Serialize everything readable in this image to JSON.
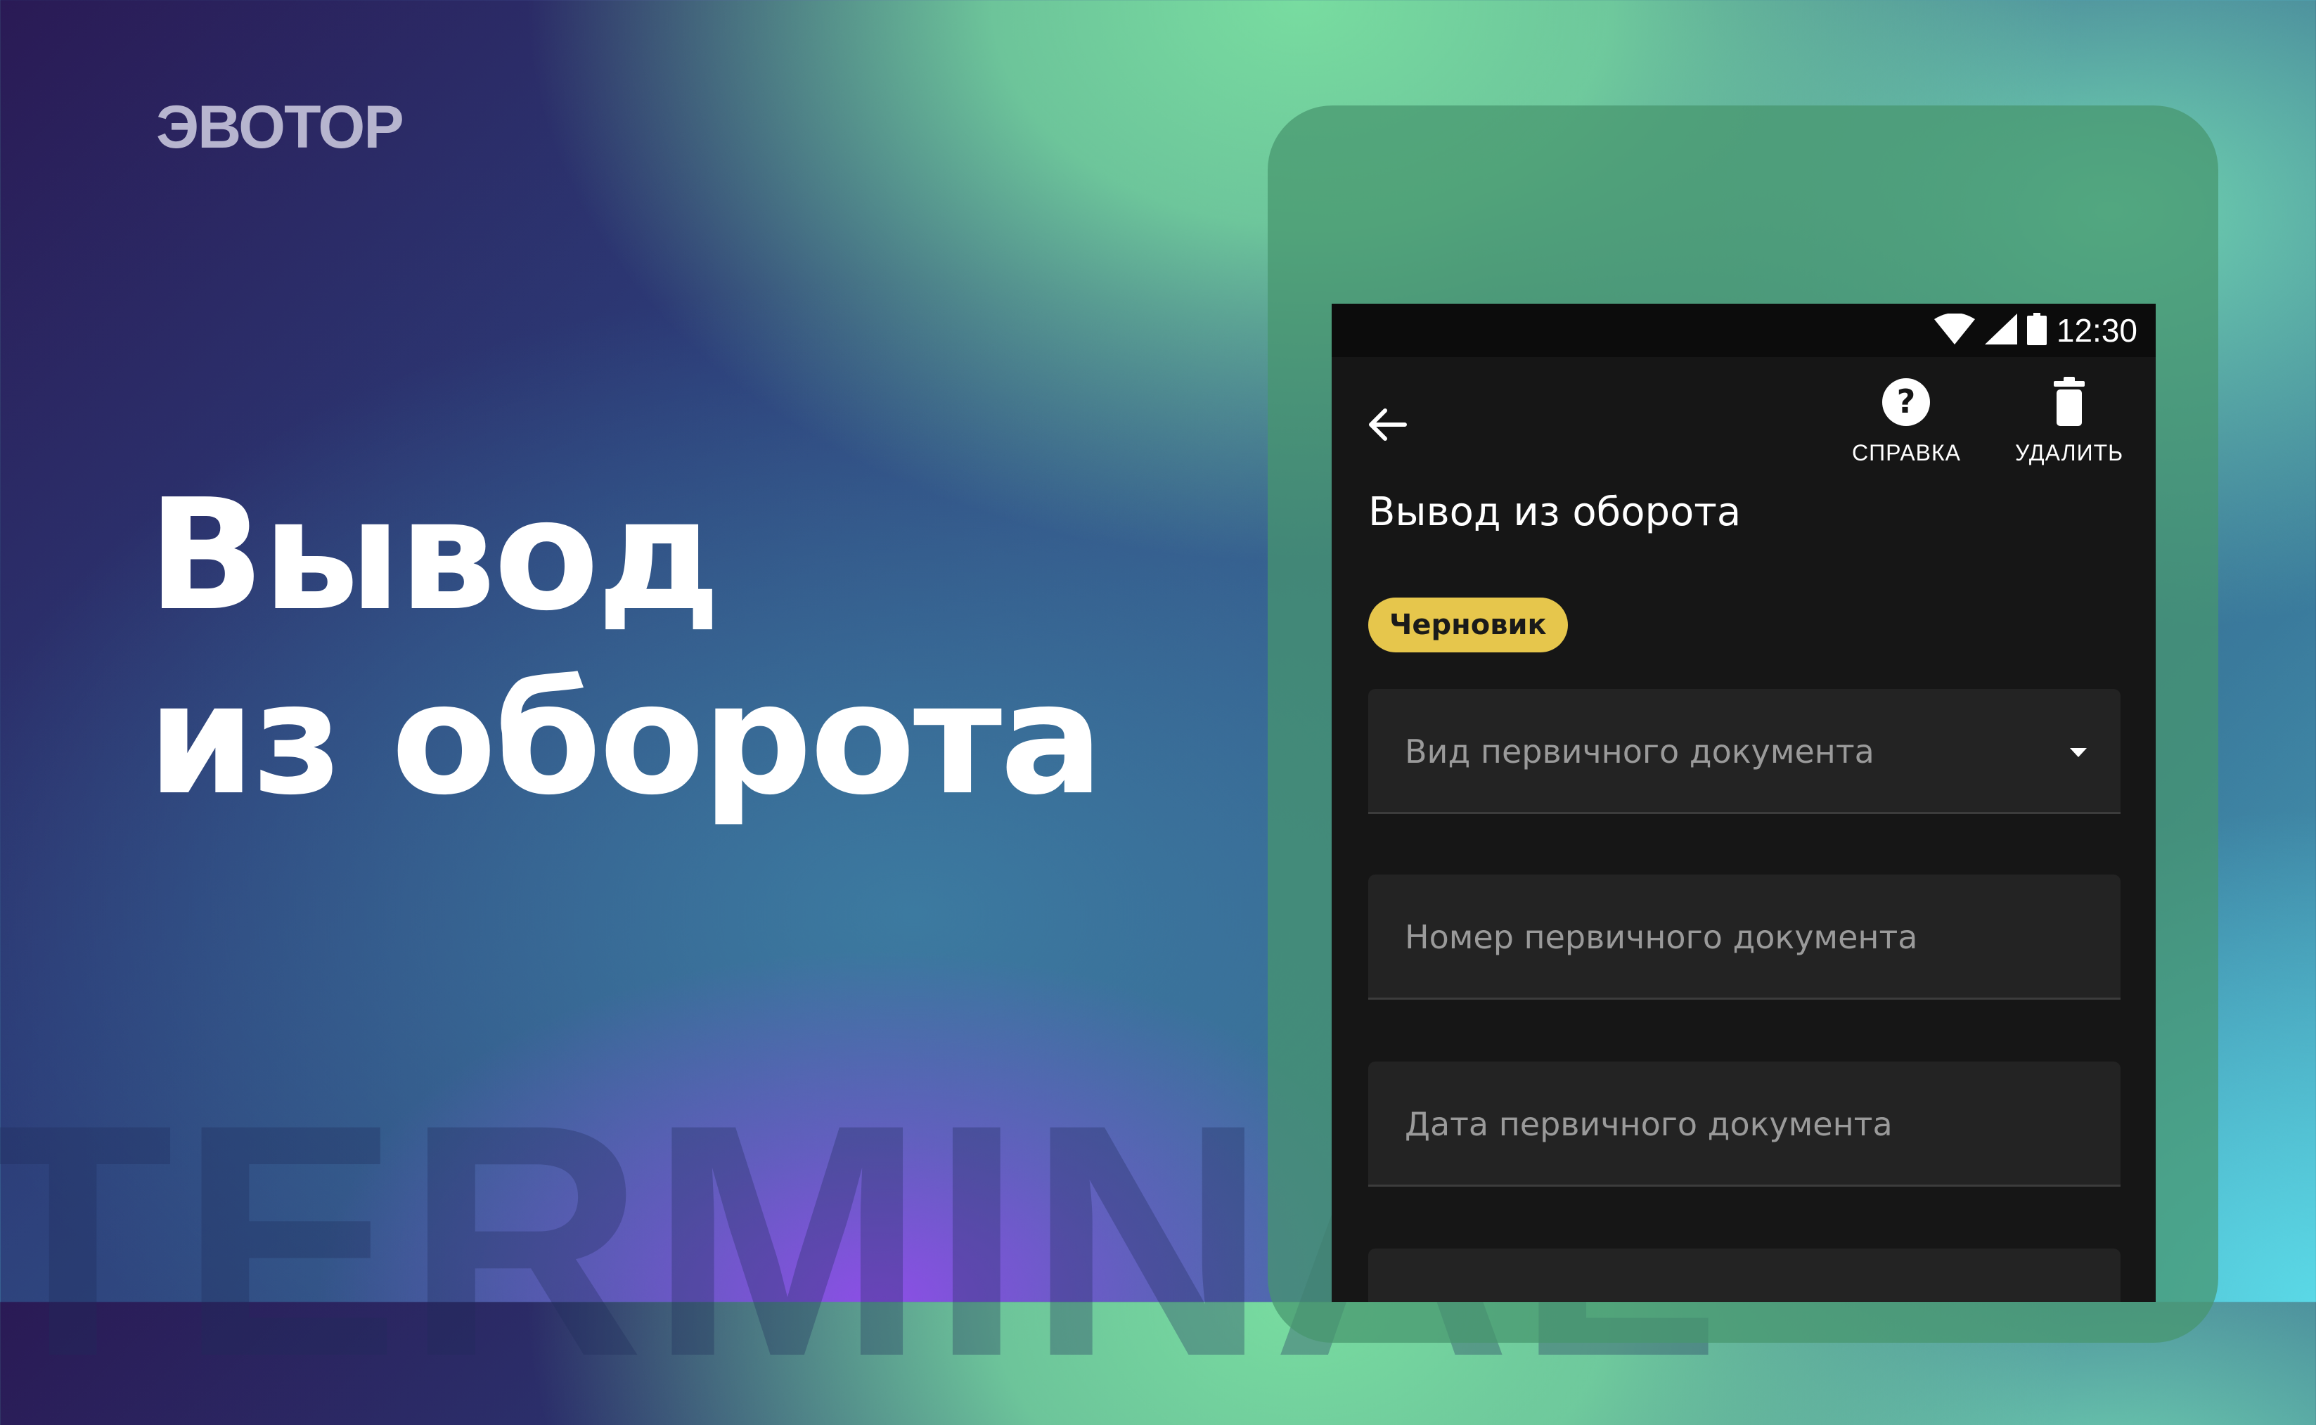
{
  "brand": {
    "logo_text": "ЭВОТОР"
  },
  "headline": {
    "line1": "Вывод",
    "line2": "из оборота"
  },
  "background_word": "TERMINAL",
  "device": {
    "status_bar": {
      "time": "12:30",
      "icons": [
        "wifi-icon",
        "cell-signal-icon",
        "battery-icon"
      ]
    },
    "toolbar": {
      "back_icon": "arrow-left-icon",
      "actions": [
        {
          "label": "СПРАВКА",
          "icon": "help-circle-icon"
        },
        {
          "label": "УДАЛИТЬ",
          "icon": "trash-icon"
        }
      ]
    },
    "title": "Вывод из оборота",
    "status_chip": "Черновик",
    "fields": [
      {
        "placeholder": "Вид первичного документа",
        "type": "dropdown"
      },
      {
        "placeholder": "Номер первичного документа",
        "type": "text"
      },
      {
        "placeholder": "Дата первичного документа",
        "type": "date"
      },
      {
        "placeholder": "",
        "type": "text"
      }
    ]
  },
  "colors": {
    "chip_background": "#e6c64c",
    "screen_background": "#161616",
    "field_background": "#232323"
  }
}
